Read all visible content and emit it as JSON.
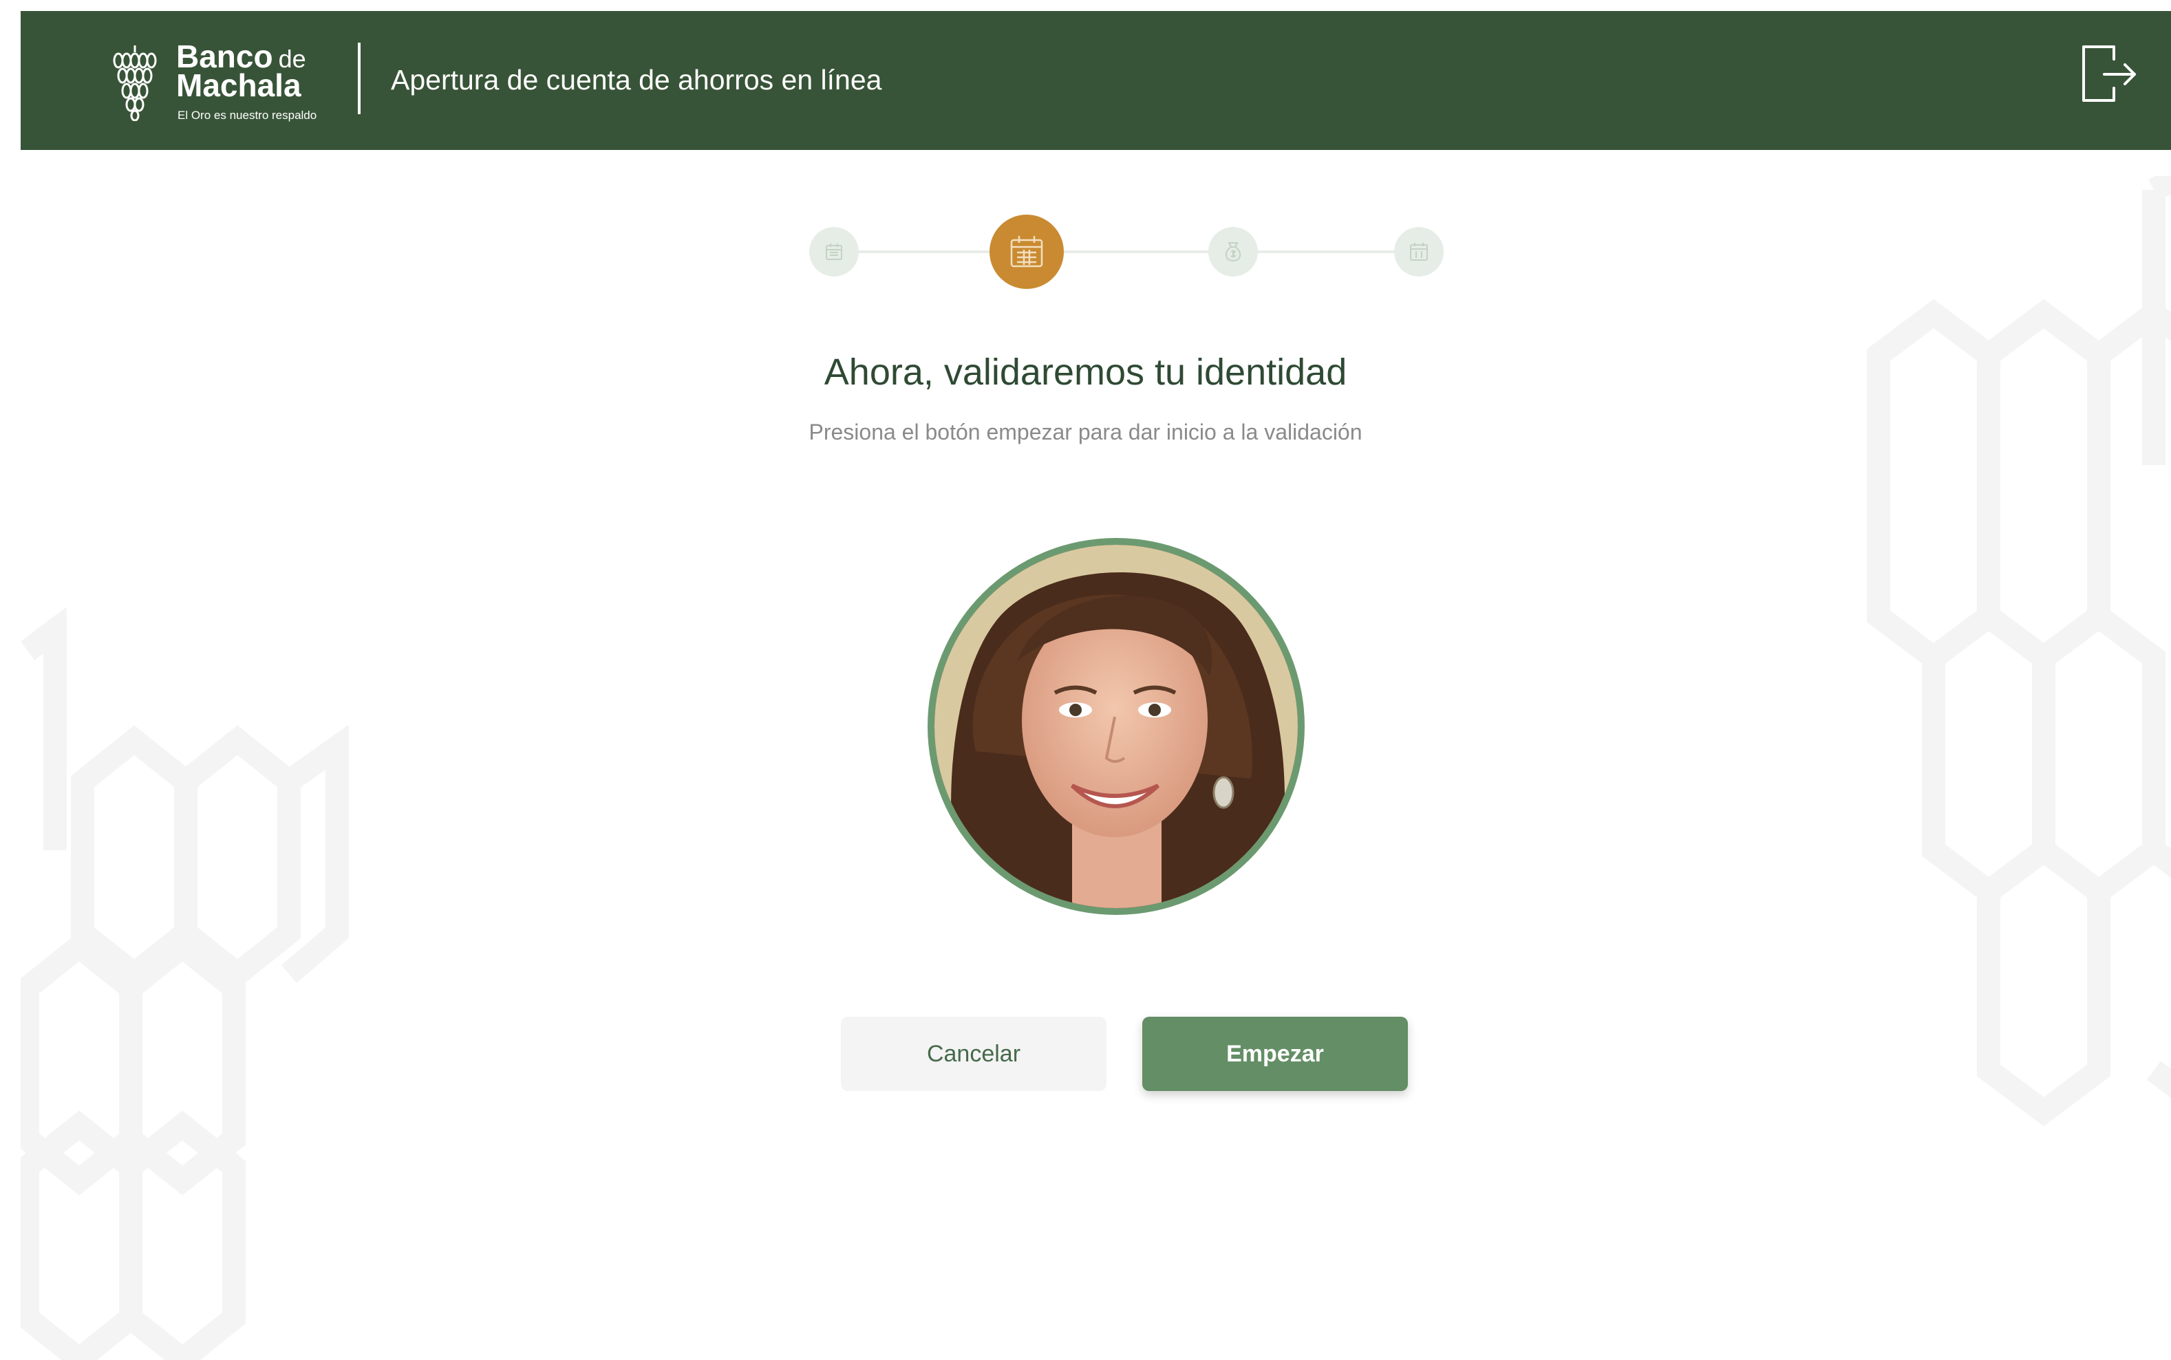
{
  "header": {
    "brand": {
      "name_line1": "Banco",
      "name_de": "de",
      "name_line2": "Machala",
      "tagline": "El Oro es nuestro respaldo"
    },
    "title": "Apertura de cuenta de ahorros en línea",
    "logout_icon": "logout-icon"
  },
  "stepper": {
    "current_step": 2,
    "total_steps": 4,
    "steps": [
      {
        "icon": "calendar-icon",
        "state": "inactive"
      },
      {
        "icon": "calendar-icon",
        "state": "active"
      },
      {
        "icon": "money-bag-icon",
        "state": "inactive"
      },
      {
        "icon": "calendar-icon",
        "state": "inactive"
      }
    ]
  },
  "main": {
    "title": "Ahora, validaremos tu identidad",
    "subtitle": "Presiona el botón empezar para dar inicio a la validación",
    "avatar_icon": "face-photo"
  },
  "actions": {
    "cancel_label": "Cancelar",
    "start_label": "Empezar"
  },
  "colors": {
    "header_bg": "#385438",
    "accent": "#c98a31",
    "primary_button": "#648e65",
    "title_text": "#2f4a34"
  }
}
